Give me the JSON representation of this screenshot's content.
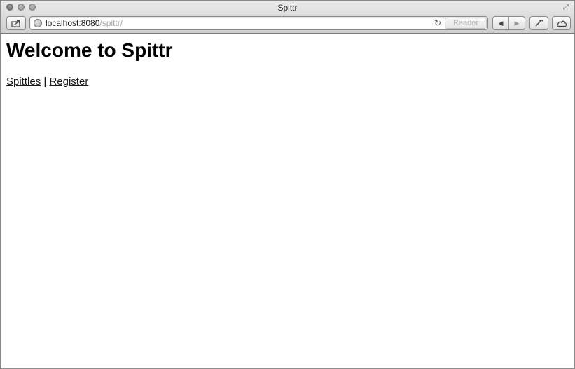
{
  "window": {
    "title": "Spittr"
  },
  "toolbar": {
    "url_host": "localhost:8080",
    "url_path": "/spittr/",
    "reader_label": "Reader"
  },
  "icons": {
    "share": "share-icon",
    "globe": "globe-icon",
    "reload": "reload-icon",
    "back": "back-arrow-icon",
    "forward": "forward-arrow-icon",
    "tools": "wrench-icon",
    "icloud": "cloud-icon",
    "fullscreen": "fullscreen-icon"
  },
  "page": {
    "heading": "Welcome to Spittr",
    "links": [
      {
        "label": "Spittles"
      },
      {
        "label": "Register"
      }
    ],
    "separator": "|"
  }
}
